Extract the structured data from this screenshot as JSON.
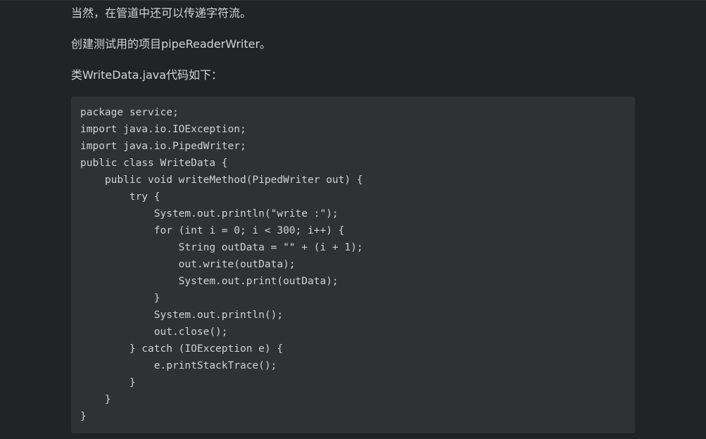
{
  "article": {
    "paragraphs": [
      "当然，在管道中还可以传递字符流。",
      "创建测试用的项目pipeReaderWriter。",
      "类WriteData.java代码如下："
    ],
    "code": {
      "language": "java",
      "lines": [
        "package service;",
        "import java.io.IOException;",
        "import java.io.PipedWriter;",
        "public class WriteData {",
        "    public void writeMethod(PipedWriter out) {",
        "        try {",
        "            System.out.println(\"write :\");",
        "            for (int i = 0; i < 300; i++) {",
        "                String outData = \"\" + (i + 1);",
        "                out.write(outData);",
        "                System.out.print(outData);",
        "            }",
        "            System.out.println();",
        "            out.close();",
        "        } catch (IOException e) {",
        "            e.printStackTrace();",
        "        }",
        "    }",
        "}"
      ]
    }
  }
}
